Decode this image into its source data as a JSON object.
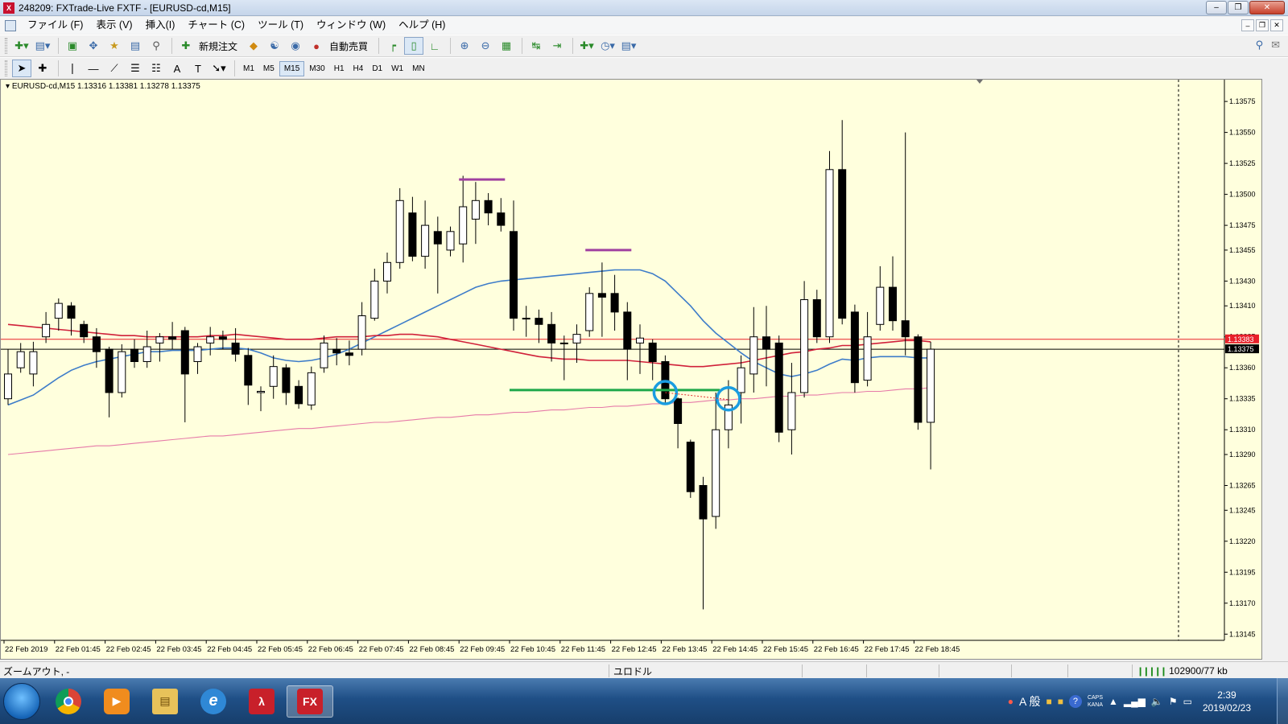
{
  "window": {
    "title": "248209: FXTrade-Live FXTF - [EURUSD-cd,M15]",
    "app_logo": "X"
  },
  "menu": [
    "ファイル (F)",
    "表示 (V)",
    "挿入(I)",
    "チャート (C)",
    "ツール (T)",
    "ウィンドウ (W)",
    "ヘルプ (H)"
  ],
  "toolbar": {
    "new_order_label": "新規注文",
    "auto_trade_label": "自動売買"
  },
  "periods": [
    "M1",
    "M5",
    "M15",
    "M30",
    "H1",
    "H4",
    "D1",
    "W1",
    "MN"
  ],
  "active_period": "M15",
  "chart": {
    "info": "EURUSD-cd,M15  1.13316 1.13381 1.13278 1.13375"
  },
  "chart_data": {
    "type": "candlestick",
    "symbol": "EURUSD-cd",
    "timeframe": "M15",
    "y_ticks": [
      1.13575,
      1.1355,
      1.13525,
      1.135,
      1.13475,
      1.13455,
      1.1343,
      1.1341,
      1.13385,
      1.1336,
      1.13335,
      1.1331,
      1.1329,
      1.13265,
      1.13245,
      1.1322,
      1.13195,
      1.1317,
      1.13145
    ],
    "x_ticks": [
      "22 Feb 2019",
      "22 Feb 01:45",
      "22 Feb 02:45",
      "22 Feb 03:45",
      "22 Feb 04:45",
      "22 Feb 05:45",
      "22 Feb 06:45",
      "22 Feb 07:45",
      "22 Feb 08:45",
      "22 Feb 09:45",
      "22 Feb 10:45",
      "22 Feb 11:45",
      "22 Feb 12:45",
      "22 Feb 13:45",
      "22 Feb 14:45",
      "22 Feb 15:45",
      "22 Feb 16:45",
      "22 Feb 17:45",
      "22 Feb 18:45"
    ],
    "price_labels": [
      {
        "text": "1.13383",
        "value": 1.13383,
        "color": "#e8202a"
      },
      {
        "text": "1.13375",
        "value": 1.13375,
        "color": "#000000"
      }
    ],
    "candles": [
      [
        1.13335,
        1.13355,
        1.13375,
        1.1333
      ],
      [
        1.1336,
        1.13373,
        1.1338,
        1.13356
      ],
      [
        1.13355,
        1.13373,
        1.13381,
        1.13345
      ],
      [
        1.13385,
        1.13395,
        1.13405,
        1.1338
      ],
      [
        1.134,
        1.13412,
        1.13416,
        1.1339
      ],
      [
        1.1341,
        1.134,
        1.13413,
        1.13386
      ],
      [
        1.13395,
        1.13385,
        1.13398,
        1.1338
      ],
      [
        1.13385,
        1.13373,
        1.13392,
        1.1336
      ],
      [
        1.13375,
        1.1334,
        1.13377,
        1.1332
      ],
      [
        1.1334,
        1.13373,
        1.13379,
        1.13336
      ],
      [
        1.13375,
        1.13365,
        1.13383,
        1.1336
      ],
      [
        1.13365,
        1.13377,
        1.1339,
        1.1336
      ],
      [
        1.1338,
        1.13385,
        1.13388,
        1.13365
      ],
      [
        1.13385,
        1.13383,
        1.13397,
        1.13375
      ],
      [
        1.1339,
        1.13355,
        1.13393,
        1.13316
      ],
      [
        1.13365,
        1.13377,
        1.1338,
        1.13355
      ],
      [
        1.1338,
        1.13385,
        1.13393,
        1.1337
      ],
      [
        1.13385,
        1.13383,
        1.1339,
        1.13375
      ],
      [
        1.1338,
        1.13371,
        1.13392,
        1.13365
      ],
      [
        1.1337,
        1.13346,
        1.13376,
        1.1333
      ],
      [
        1.1334,
        1.13341,
        1.13345,
        1.13325
      ],
      [
        1.13345,
        1.13361,
        1.1337,
        1.13335
      ],
      [
        1.1336,
        1.1334,
        1.13363,
        1.1333
      ],
      [
        1.13345,
        1.13331,
        1.1335,
        1.13327
      ],
      [
        1.1333,
        1.13356,
        1.13361,
        1.13326
      ],
      [
        1.1336,
        1.1338,
        1.13386,
        1.13356
      ],
      [
        1.13375,
        1.13372,
        1.13384,
        1.13362
      ],
      [
        1.13372,
        1.1337,
        1.13382,
        1.13362
      ],
      [
        1.13375,
        1.13402,
        1.13413,
        1.1337
      ],
      [
        1.134,
        1.1343,
        1.1344,
        1.13398
      ],
      [
        1.1343,
        1.13445,
        1.13453,
        1.1342
      ],
      [
        1.13445,
        1.13495,
        1.13505,
        1.1344
      ],
      [
        1.13485,
        1.1345,
        1.13498,
        1.13446
      ],
      [
        1.1345,
        1.13475,
        1.13495,
        1.1344
      ],
      [
        1.1347,
        1.1346,
        1.13482,
        1.1342
      ],
      [
        1.13455,
        1.1347,
        1.13474,
        1.1345
      ],
      [
        1.1346,
        1.1349,
        1.13515,
        1.13445
      ],
      [
        1.1348,
        1.13495,
        1.1351,
        1.1346
      ],
      [
        1.13495,
        1.13485,
        1.13501,
        1.13475
      ],
      [
        1.13485,
        1.13475,
        1.13497,
        1.1347
      ],
      [
        1.1347,
        1.134,
        1.13495,
        1.1339
      ],
      [
        1.134,
        1.134,
        1.1341,
        1.13385
      ],
      [
        1.134,
        1.13395,
        1.13407,
        1.1338
      ],
      [
        1.13395,
        1.1338,
        1.13405,
        1.13365
      ],
      [
        1.1338,
        1.1338,
        1.13386,
        1.1335
      ],
      [
        1.1338,
        1.13387,
        1.13395,
        1.13364
      ],
      [
        1.1339,
        1.1342,
        1.13425,
        1.13385
      ],
      [
        1.1342,
        1.13417,
        1.13445,
        1.13385
      ],
      [
        1.1342,
        1.13405,
        1.13435,
        1.1339
      ],
      [
        1.13405,
        1.13375,
        1.13413,
        1.1335
      ],
      [
        1.1338,
        1.13384,
        1.13395,
        1.13355
      ],
      [
        1.1338,
        1.13365,
        1.13383,
        1.1335
      ],
      [
        1.13365,
        1.13335,
        1.1337,
        1.1333
      ],
      [
        1.13335,
        1.13315,
        1.13336,
        1.13295
      ],
      [
        1.133,
        1.1326,
        1.13302,
        1.13255
      ],
      [
        1.13265,
        1.13238,
        1.13272,
        1.13165
      ],
      [
        1.1324,
        1.1331,
        1.1334,
        1.1323
      ],
      [
        1.1331,
        1.1333,
        1.1335,
        1.13295
      ],
      [
        1.1334,
        1.1336,
        1.1337,
        1.13315
      ],
      [
        1.13355,
        1.13385,
        1.13409,
        1.1334
      ],
      [
        1.13385,
        1.13375,
        1.1341,
        1.13345
      ],
      [
        1.1338,
        1.13308,
        1.13386,
        1.133
      ],
      [
        1.1331,
        1.1334,
        1.13364,
        1.1329
      ],
      [
        1.1334,
        1.13415,
        1.1343,
        1.13336
      ],
      [
        1.13415,
        1.13385,
        1.13423,
        1.1338
      ],
      [
        1.13385,
        1.1352,
        1.13535,
        1.1338
      ],
      [
        1.1352,
        1.134,
        1.1356,
        1.13395
      ],
      [
        1.13405,
        1.13348,
        1.13411,
        1.1334
      ],
      [
        1.1335,
        1.13385,
        1.13405,
        1.13345
      ],
      [
        1.13395,
        1.13425,
        1.13442,
        1.1339
      ],
      [
        1.13425,
        1.13398,
        1.1345,
        1.1339
      ],
      [
        1.13398,
        1.13385,
        1.1355,
        1.1337
      ],
      [
        1.13385,
        1.13316,
        1.13387,
        1.1331
      ],
      [
        1.13316,
        1.13375,
        1.13381,
        1.13278
      ]
    ],
    "indicators": [
      {
        "type": "moving-average",
        "color": "#3d7cc9",
        "values": [
          1.1333,
          1.13334,
          1.13338,
          1.13345,
          1.13352,
          1.13358,
          1.13362,
          1.13365,
          1.13367,
          1.13369,
          1.13371,
          1.13373,
          1.13373,
          1.13374,
          1.13374,
          1.13374,
          1.13375,
          1.13376,
          1.13376,
          1.13375,
          1.13372,
          1.13368,
          1.13366,
          1.13365,
          1.13366,
          1.13368,
          1.13371,
          1.13375,
          1.1338,
          1.13385,
          1.1339,
          1.13395,
          1.134,
          1.13405,
          1.1341,
          1.13415,
          1.1342,
          1.13425,
          1.13428,
          1.1343,
          1.13431,
          1.13432,
          1.13433,
          1.13434,
          1.13435,
          1.13436,
          1.13437,
          1.13438,
          1.13439,
          1.13439,
          1.13439,
          1.13436,
          1.1343,
          1.1342,
          1.1341,
          1.13398,
          1.13388,
          1.1338,
          1.13372,
          1.13365,
          1.1336,
          1.13355,
          1.13353,
          1.13355,
          1.13358,
          1.13363,
          1.13367,
          1.13366,
          1.13368,
          1.13369,
          1.13369,
          1.13369,
          1.13368,
          1.13368
        ]
      },
      {
        "type": "moving-average",
        "color": "#d0203a",
        "values": [
          1.13395,
          1.13394,
          1.13393,
          1.13392,
          1.13391,
          1.1339,
          1.13389,
          1.13388,
          1.13387,
          1.13386,
          1.13386,
          1.13385,
          1.13385,
          1.13385,
          1.13385,
          1.13385,
          1.13386,
          1.13386,
          1.13387,
          1.13386,
          1.13385,
          1.13384,
          1.13383,
          1.13383,
          1.13383,
          1.13384,
          1.13385,
          1.13385,
          1.13385,
          1.13386,
          1.13386,
          1.13387,
          1.13387,
          1.13386,
          1.13385,
          1.13383,
          1.13381,
          1.13379,
          1.13377,
          1.13375,
          1.13373,
          1.13371,
          1.13369,
          1.13368,
          1.13367,
          1.13367,
          1.13366,
          1.13366,
          1.13366,
          1.13366,
          1.13365,
          1.13364,
          1.13363,
          1.13362,
          1.13361,
          1.13361,
          1.13362,
          1.13363,
          1.13364,
          1.13366,
          1.13368,
          1.1337,
          1.13372,
          1.13373,
          1.13375,
          1.13376,
          1.13378,
          1.13378,
          1.13379,
          1.1338,
          1.13381,
          1.13382,
          1.13382,
          1.13381
        ]
      },
      {
        "type": "moving-average",
        "color": "#e67aa8",
        "values": [
          1.1329,
          1.13291,
          1.13292,
          1.13293,
          1.13294,
          1.13295,
          1.13296,
          1.13297,
          1.13297,
          1.13298,
          1.13299,
          1.133,
          1.13301,
          1.13302,
          1.13303,
          1.13304,
          1.13305,
          1.13305,
          1.13306,
          1.13307,
          1.13308,
          1.13309,
          1.1331,
          1.13311,
          1.13311,
          1.13312,
          1.13313,
          1.13314,
          1.13315,
          1.13316,
          1.13316,
          1.13317,
          1.13318,
          1.13319,
          1.1332,
          1.1332,
          1.13321,
          1.13322,
          1.13322,
          1.13323,
          1.13324,
          1.13324,
          1.13325,
          1.13326,
          1.13326,
          1.13327,
          1.13328,
          1.13328,
          1.13329,
          1.13329,
          1.1333,
          1.13331,
          1.13331,
          1.13332,
          1.13332,
          1.13333,
          1.13334,
          1.13334,
          1.13335,
          1.13335,
          1.13336,
          1.13337,
          1.13337,
          1.13338,
          1.13338,
          1.13339,
          1.1334,
          1.1334,
          1.13341,
          1.13341,
          1.13342,
          1.13343,
          1.13343,
          1.13344
        ]
      }
    ],
    "drawn_objects": {
      "horizontal_segments": [
        {
          "price": 1.13512,
          "color": "#a040a0",
          "from_candle": 36,
          "to_candle": 39
        },
        {
          "price": 1.13455,
          "color": "#a040a0",
          "from_candle": 46,
          "to_candle": 49
        },
        {
          "price": 1.13342,
          "color": "#1ea84a",
          "from_candle": 40,
          "to_candle": 56
        }
      ],
      "circles": [
        {
          "candle": 52,
          "price": 1.1334,
          "color": "#1a9ce0"
        },
        {
          "candle": 57,
          "price": 1.13335,
          "color": "#1a9ce0"
        }
      ]
    }
  },
  "status": {
    "hint": "ズームアウト, -",
    "symbol_name": "ユロドル",
    "traffic": "102900/77 kb"
  },
  "taskbar": {
    "apps": [
      "windows-start",
      "chrome",
      "media-player",
      "file-explorer",
      "internet-explorer",
      "acrobat-reader",
      "fxtf-mt4"
    ],
    "fx_label": "FX",
    "ime_label": "A 般",
    "caps_label": "CAPS",
    "kana_label": "KANA",
    "time": "2:39",
    "date": "2019/02/23"
  }
}
